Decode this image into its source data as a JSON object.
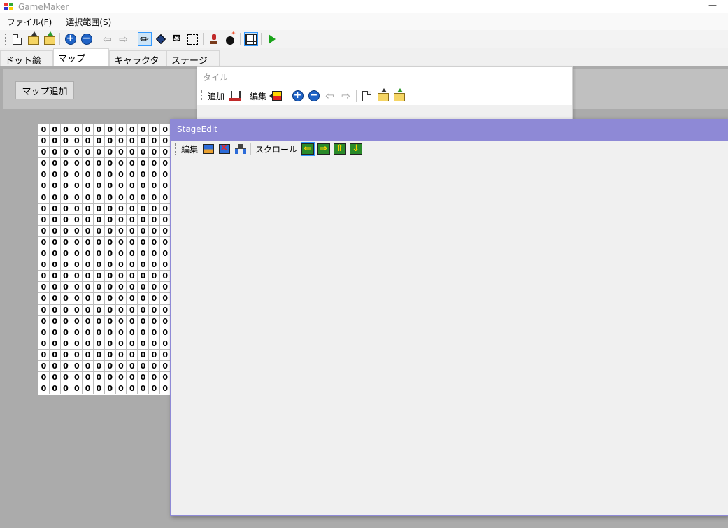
{
  "window": {
    "title": "GameMaker",
    "minimize_glyph": "—"
  },
  "menu": {
    "items": [
      "ファイル(F)",
      "選択範囲(S)"
    ]
  },
  "toolbar": {
    "icons": [
      "new-file-icon",
      "open-folder-icon",
      "save-folder-icon",
      "zoom-in-icon",
      "zoom-out-icon",
      "undo-arrow-icon",
      "redo-arrow-icon",
      "pencil-icon",
      "eraser-icon",
      "fill-bucket-icon",
      "rect-select-icon",
      "stamp-icon",
      "bomb-icon",
      "grid-icon",
      "play-icon"
    ],
    "zoom_in_glyph": "+",
    "zoom_out_glyph": "−",
    "left_arrow": "⇦",
    "right_arrow": "⇨",
    "pencil_glyph": "✏",
    "fill_glyph": "⛾",
    "active_tool": "pencil"
  },
  "tabs": [
    {
      "label": "ドット絵",
      "selected": false
    },
    {
      "label": "マップ",
      "selected": true
    },
    {
      "label": "キャラクター",
      "selected": false
    },
    {
      "label": "ステージ",
      "selected": false
    }
  ],
  "map": {
    "add_button": "マップ追加",
    "cell_value": "0",
    "columns": 12,
    "rows": 24
  },
  "tile_window": {
    "title": "タイル",
    "add_label": "追加",
    "edit_label": "編集",
    "zoom_in_glyph": "+",
    "zoom_out_glyph": "−",
    "left_arrow": "⇦",
    "right_arrow": "⇨"
  },
  "stage_window": {
    "title": "StageEdit",
    "edit_label": "編集",
    "scroll_label": "スクロール",
    "scroll_left_glyph": "⇐",
    "scroll_right_glyph": "⇒",
    "scroll_up_glyph": "⇑",
    "scroll_down_glyph": "⇓",
    "accent_color": "#8e89d6"
  }
}
